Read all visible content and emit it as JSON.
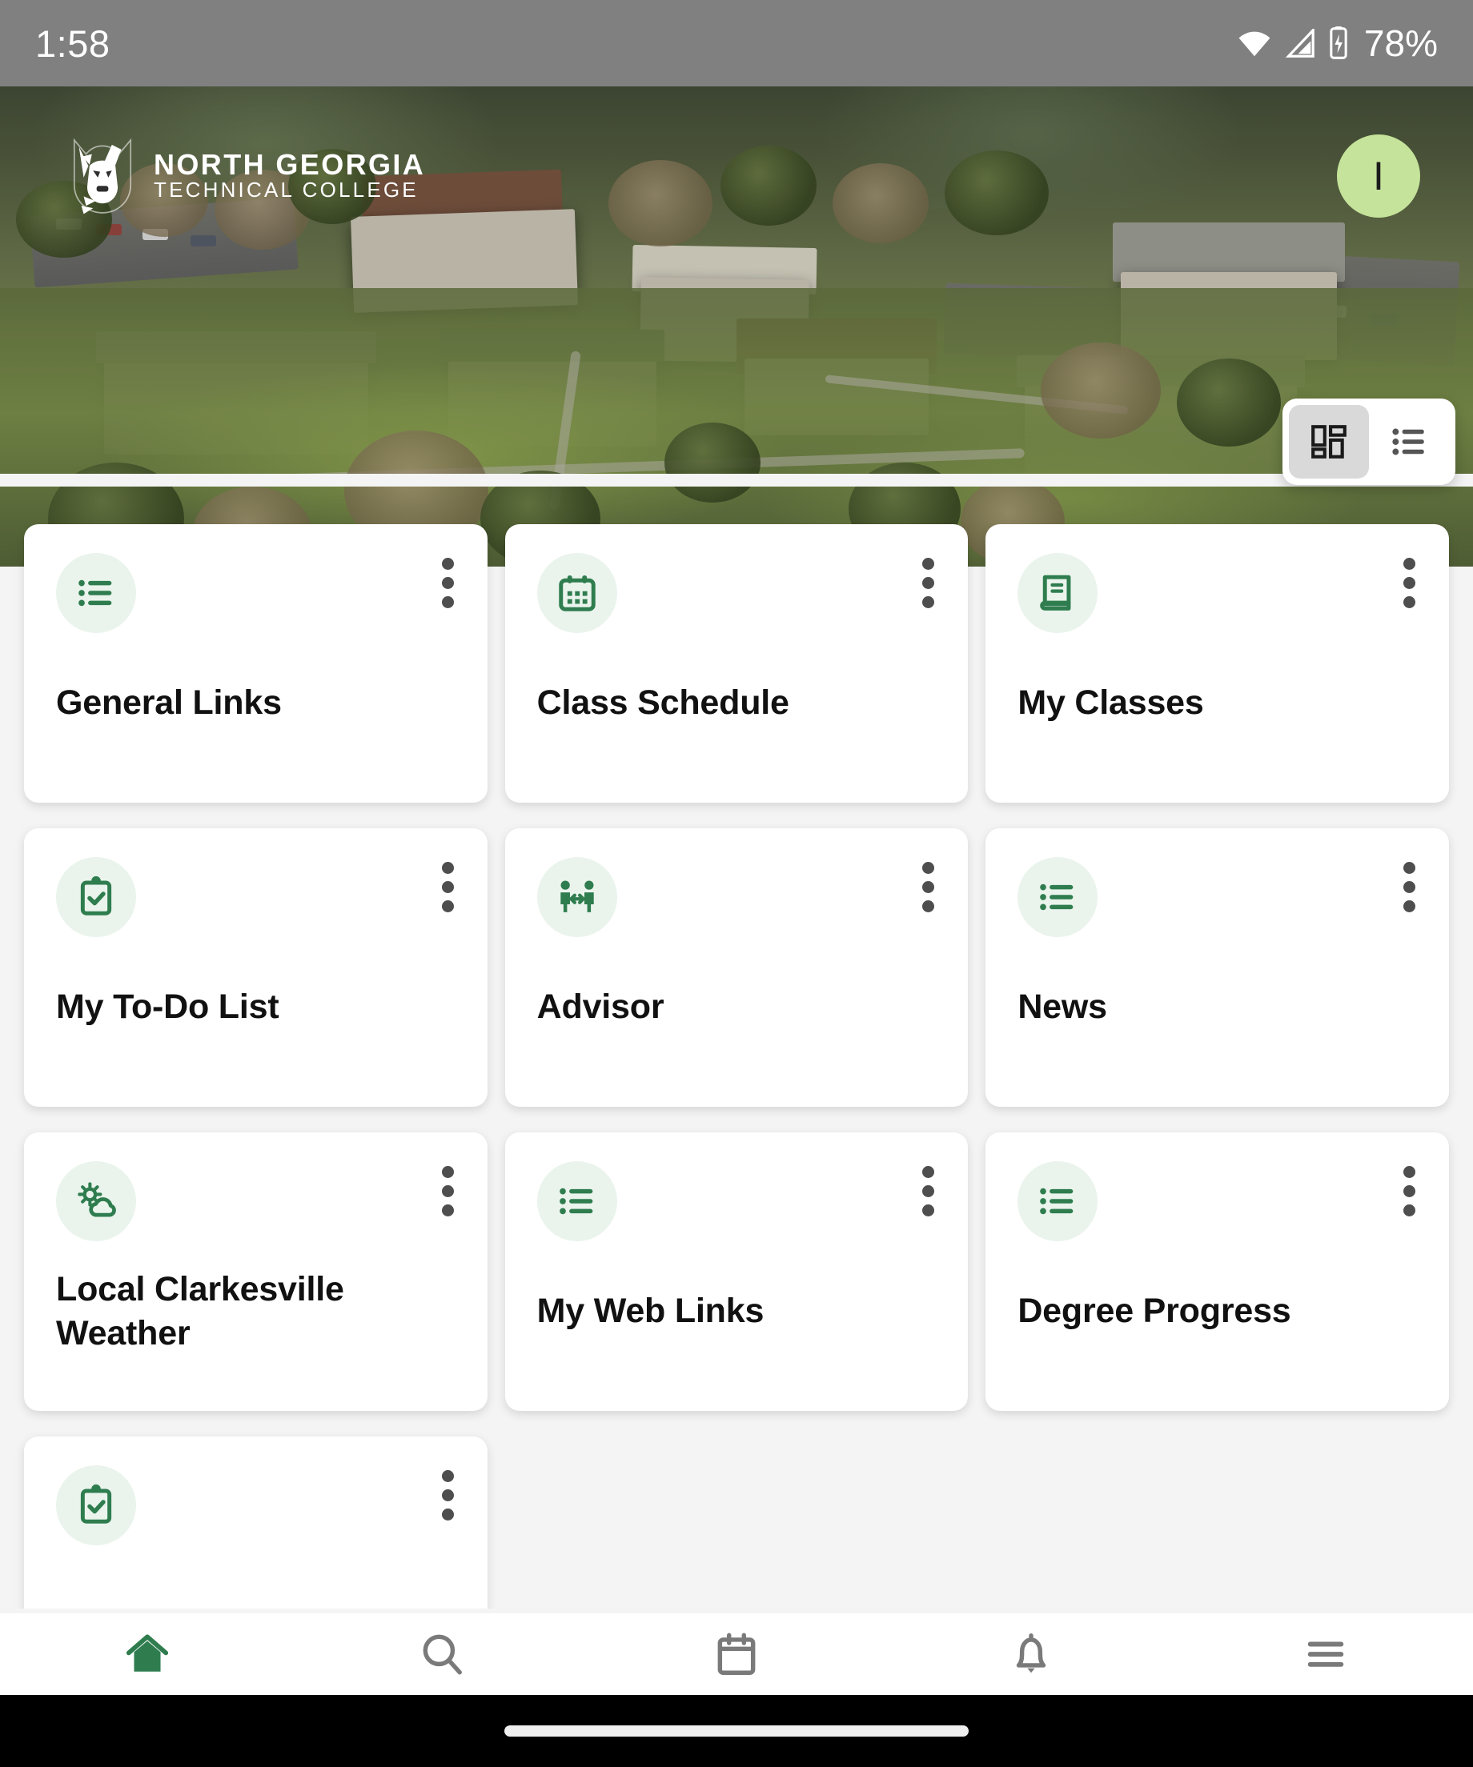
{
  "status_bar": {
    "time": "1:58",
    "battery_percent": "78%",
    "icons": [
      "wifi-icon",
      "cellular-signal-icon",
      "battery-icon"
    ]
  },
  "header": {
    "logo": {
      "icon": "wolf-head-logo-icon",
      "line1": "NORTH GEORGIA",
      "line2": "TECHNICAL COLLEGE"
    },
    "avatar_initial": "I",
    "avatar_color": "#c5e39a"
  },
  "view_toggle": {
    "options": [
      {
        "name": "grid-view",
        "icon": "grid-view-icon",
        "selected": true
      },
      {
        "name": "list-view",
        "icon": "list-view-icon",
        "selected": false
      }
    ]
  },
  "theme": {
    "accent_green": "#2f7d4f",
    "icon_bubble": "#eaf4ec",
    "card_bg": "#ffffff",
    "page_bg": "#f4f4f4",
    "status_bar_bg": "#808080"
  },
  "cards": [
    {
      "title": "General Links",
      "icon": "list-icon",
      "menu": "more-options-icon"
    },
    {
      "title": "Class Schedule",
      "icon": "calendar-icon",
      "menu": "more-options-icon"
    },
    {
      "title": "My Classes",
      "icon": "book-icon",
      "menu": "more-options-icon"
    },
    {
      "title": "My To-Do List",
      "icon": "clipboard-check-icon",
      "menu": "more-options-icon"
    },
    {
      "title": "Advisor",
      "icon": "people-exchange-icon",
      "menu": "more-options-icon"
    },
    {
      "title": "News",
      "icon": "list-icon",
      "menu": "more-options-icon"
    },
    {
      "title": "Local Clarkesville Weather",
      "icon": "sun-cloud-icon",
      "menu": "more-options-icon"
    },
    {
      "title": "My Web Links",
      "icon": "list-icon",
      "menu": "more-options-icon"
    },
    {
      "title": "Degree Progress",
      "icon": "list-icon",
      "menu": "more-options-icon"
    },
    {
      "title": "",
      "icon": "clipboard-check-icon",
      "menu": "more-options-icon"
    }
  ],
  "bottom_nav": [
    {
      "name": "home",
      "icon": "home-icon",
      "active": true
    },
    {
      "name": "search",
      "icon": "search-icon",
      "active": false
    },
    {
      "name": "calendar",
      "icon": "calendar-icon",
      "active": false
    },
    {
      "name": "notifications",
      "icon": "bell-icon",
      "active": false
    },
    {
      "name": "menu",
      "icon": "hamburger-menu-icon",
      "active": false
    }
  ]
}
